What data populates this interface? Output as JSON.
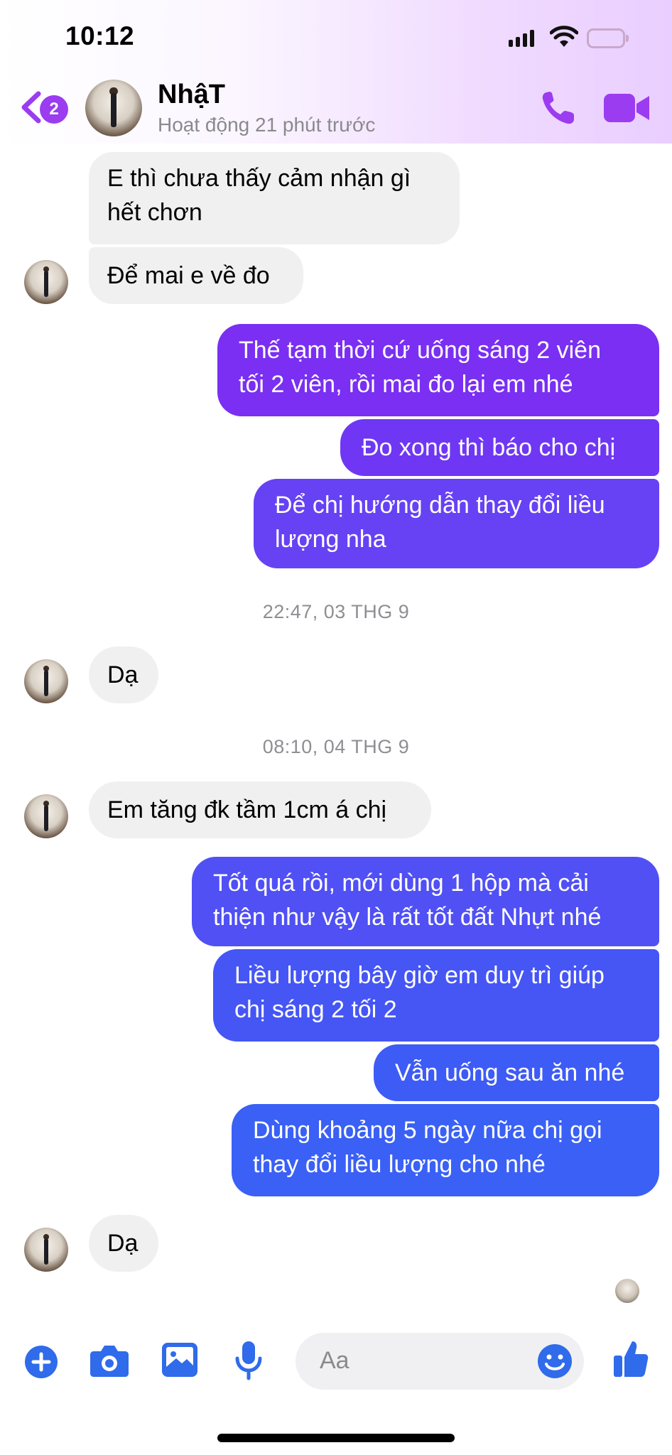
{
  "status_bar": {
    "time": "10:12"
  },
  "header": {
    "back_badge": "2",
    "contact_name": "NhậT",
    "contact_status": "Hoạt động 21 phút trước"
  },
  "messages": [
    {
      "side": "in",
      "text": [
        "E thì chưa thấy cảm nhận gì",
        "hết chơn"
      ]
    },
    {
      "side": "in",
      "text": [
        "Để mai e về đo"
      ]
    },
    {
      "side": "out",
      "text": [
        "Thế tạm thời cứ uống sáng 2 viên",
        "tối 2 viên, rồi mai đo lại em nhé"
      ]
    },
    {
      "side": "out",
      "text": [
        "Đo xong thì báo cho chị"
      ]
    },
    {
      "side": "out",
      "text": [
        "Để chị hướng dẫn thay đổi liều",
        "lượng nha"
      ]
    },
    {
      "type": "timestamp",
      "text": "22:47, 03 THG 9"
    },
    {
      "side": "in",
      "text": [
        "Dạ"
      ]
    },
    {
      "type": "timestamp",
      "text": "08:10, 04 THG 9"
    },
    {
      "side": "in",
      "text": [
        "Em tăng đk tầm 1cm á chị"
      ]
    },
    {
      "side": "out",
      "text": [
        "Tốt quá rồi, mới dùng 1 hộp mà cải",
        "thiện như vậy là rất tốt đất Nhựt nhé"
      ]
    },
    {
      "side": "out",
      "text": [
        "Liều lượng bây giờ em duy trì giúp",
        "chị sáng 2 tối 2"
      ]
    },
    {
      "side": "out",
      "text": [
        "Vẫn uống sau ăn nhé"
      ]
    },
    {
      "side": "out",
      "text": [
        "Dùng khoảng 5 ngày nữa chị gọi",
        "thay đổi liều lượng cho nhé"
      ]
    },
    {
      "side": "in",
      "text": [
        "Dạ"
      ]
    }
  ],
  "composer": {
    "placeholder": "Aa"
  },
  "colors": {
    "accent": "#9b3cf0",
    "out_bubble_purple": "#7a2ff2",
    "out_bubble_blue": "#3b5bf5",
    "in_bubble": "#f0f0f0",
    "composer_icons": "#2f6bea"
  }
}
